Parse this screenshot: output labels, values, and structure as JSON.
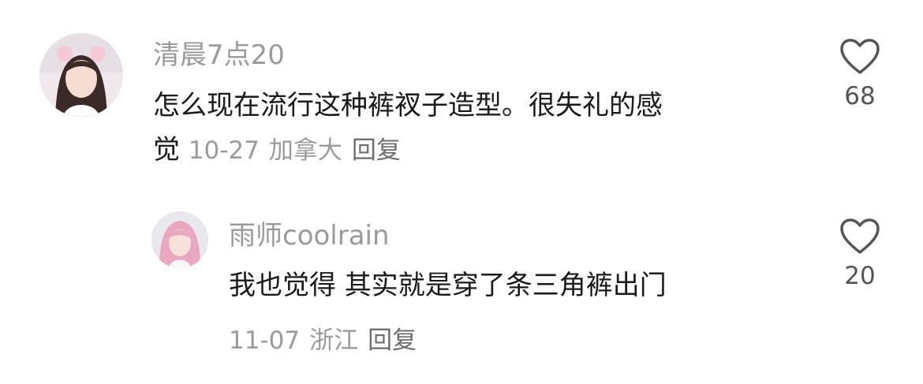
{
  "comments": [
    {
      "username": "清晨7点20",
      "text": "怎么现在流行这种裤衩子造型。很失礼的感觉",
      "text_line1": "怎么现在流行这种裤衩子造型。很失礼的感",
      "text_line2_start": "觉",
      "date": "10-27",
      "location": "加拿大",
      "reply_label": "回复",
      "likes": "68",
      "icons": {
        "like": "heart-outline-icon"
      }
    },
    {
      "username": "雨师coolrain",
      "text": "我也觉得 其实就是穿了条三角裤出门",
      "date": "11-07",
      "location": "浙江",
      "reply_label": "回复",
      "likes": "20",
      "icons": {
        "like": "heart-outline-icon"
      }
    }
  ],
  "colors": {
    "name": "#9a9a9a",
    "text": "#1a1a1a",
    "meta": "#9a9a9a",
    "heart_stroke": "#555555"
  }
}
